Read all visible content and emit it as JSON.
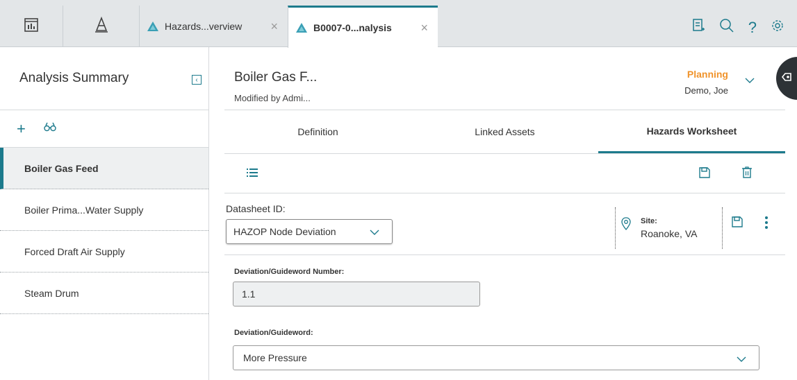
{
  "topbar": {
    "tabs": [
      {
        "label": "Hazards...verview",
        "active": false
      },
      {
        "label": "B0007-0...nalysis",
        "active": true
      }
    ],
    "icons": [
      "dashboard-icon",
      "asset-hierarchy-icon",
      "notes-icon",
      "search-icon",
      "help-icon",
      "settings-icon"
    ]
  },
  "left": {
    "title": "Analysis Summary",
    "items": [
      {
        "label": "Boiler Gas Feed",
        "selected": true
      },
      {
        "label": "Boiler Prima...Water Supply",
        "selected": false
      },
      {
        "label": "Forced Draft Air Supply",
        "selected": false
      },
      {
        "label": "Steam Drum",
        "selected": false
      }
    ]
  },
  "header": {
    "title": "Boiler Gas F...",
    "modified": "Modified by Admi...",
    "state": "Planning",
    "user": "Demo, Joe"
  },
  "tabs": [
    {
      "label": "Definition",
      "active": false
    },
    {
      "label": "Linked Assets",
      "active": false
    },
    {
      "label": "Hazards Worksheet",
      "active": true
    }
  ],
  "datasheet": {
    "label": "Datasheet ID:",
    "value": "HAZOP Node Deviation",
    "site_label": "Site:",
    "site_value": "Roanoke, VA"
  },
  "fields": {
    "number_label": "Deviation/Guideword Number:",
    "number_value": "1.1",
    "guideword_label": "Deviation/Guideword:",
    "guideword_value": "More Pressure"
  },
  "colors": {
    "accent": "#1c7a8c",
    "state": "#f0932b",
    "tab_bg": "#e3e6e8"
  }
}
